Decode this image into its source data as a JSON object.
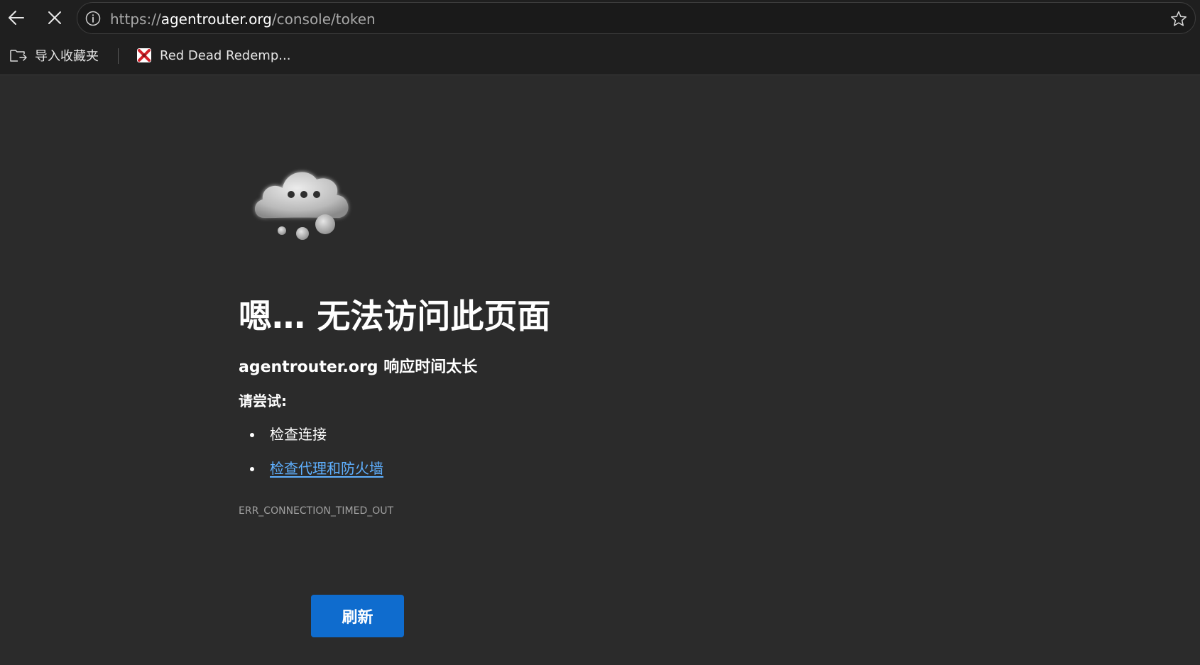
{
  "browser": {
    "address_bar": {
      "url_scheme": "https://",
      "url_host": "agentrouter.org",
      "url_path": "/console/token"
    },
    "bookmarks": [
      {
        "label": "导入收藏夹",
        "icon": "import-favorites-icon"
      },
      {
        "label": "Red Dead Redemp...",
        "icon": "rdr-favicon"
      }
    ],
    "icons": {
      "back": "back-arrow-icon",
      "stop": "stop-loading-icon",
      "site_info": "info-icon",
      "favorite": "star-icon"
    }
  },
  "error_page": {
    "title": "嗯… 无法访问此页面",
    "subtitle": "agentrouter.org 响应时间太长",
    "try_label": "请尝试:",
    "suggestions": [
      {
        "text": "检查连接",
        "is_link": false
      },
      {
        "text": "检查代理和防火墙",
        "is_link": true
      }
    ],
    "error_code": "ERR_CONNECTION_TIMED_OUT",
    "refresh_label": "刷新",
    "illustration": "thinking-cloud-icon"
  },
  "colors": {
    "page_background": "#2b2b2b",
    "toolbar_background": "#1f1f1f",
    "link": "#5fb0ff",
    "button_primary": "#0f6cce"
  }
}
